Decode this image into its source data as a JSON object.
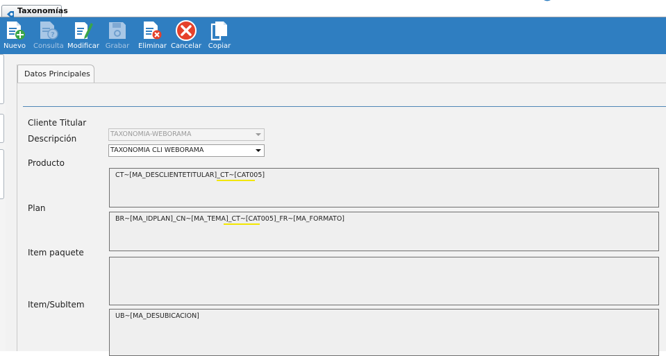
{
  "window_tab": {
    "label": "Taxonomías"
  },
  "toolbar": {
    "buttons": [
      {
        "label": "Nuevo",
        "icon": "new-document-icon",
        "enabled": true
      },
      {
        "label": "Consulta",
        "icon": "query-document-icon",
        "enabled": false
      },
      {
        "label": "Modificar",
        "icon": "edit-document-icon",
        "enabled": true
      },
      {
        "label": "Grabar",
        "icon": "save-disk-icon",
        "enabled": false
      },
      {
        "label": "Eliminar",
        "icon": "delete-document-icon",
        "enabled": true
      },
      {
        "label": "Cancelar",
        "icon": "cancel-icon",
        "enabled": true
      },
      {
        "label": "Copiar",
        "icon": "copy-icon",
        "enabled": true
      }
    ]
  },
  "section_tab": {
    "label": "Datos Principales"
  },
  "form": {
    "cliente_titular": {
      "label": "Cliente Titular",
      "value": "TAXONOMIA-WEBORAMA",
      "disabled": true
    },
    "descripcion": {
      "label": "Descripción",
      "value": "TAXONOMIA CLI WEBORAMA"
    },
    "producto": {
      "label": "Producto",
      "value": "CT~[MA_DESCLIENTETITULAR]_CT~[CAT005]"
    },
    "plan": {
      "label": "Plan",
      "value": "BR~[MA_IDPLAN]_CN~[MA_TEMA]_CT~[CAT005]_FR~[MA_FORMATO]"
    },
    "item_paquete": {
      "label": "Item paquete",
      "value": ""
    },
    "item_subitem": {
      "label": "Item/SubItem",
      "value": "UB~[MA_DESUBICACION]"
    }
  },
  "colors": {
    "toolbar_bg": "#2f7ec1",
    "highlight": "#f2e600",
    "accent_rule": "#4f86b7"
  }
}
